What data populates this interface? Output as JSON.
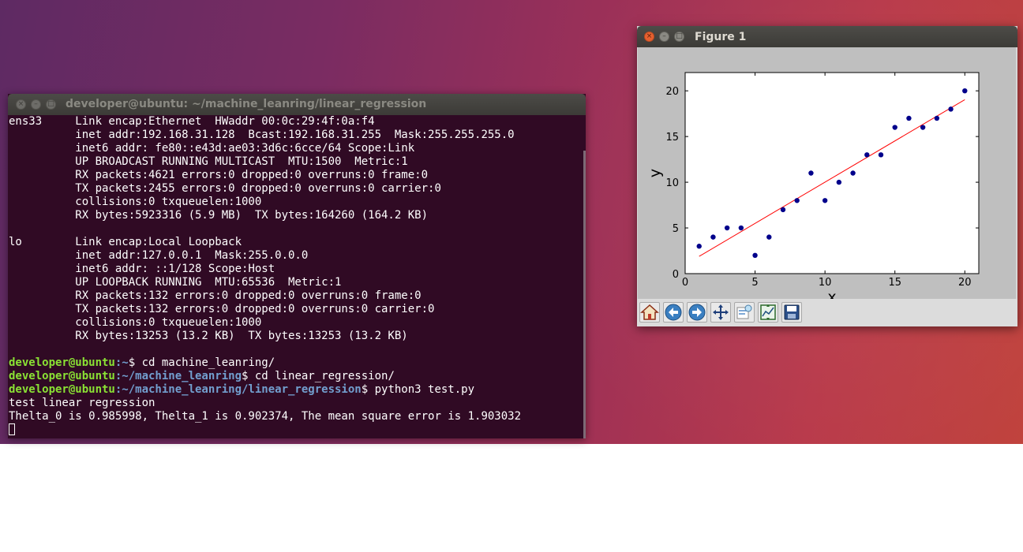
{
  "terminal": {
    "title": "developer@ubuntu: ~/machine_leanring/linear_regression",
    "lines": [
      "ens33     Link encap:Ethernet  HWaddr 00:0c:29:4f:0a:f4  ",
      "          inet addr:192.168.31.128  Bcast:192.168.31.255  Mask:255.255.255.0",
      "          inet6 addr: fe80::e43d:ae03:3d6c:6cce/64 Scope:Link",
      "          UP BROADCAST RUNNING MULTICAST  MTU:1500  Metric:1",
      "          RX packets:4621 errors:0 dropped:0 overruns:0 frame:0",
      "          TX packets:2455 errors:0 dropped:0 overruns:0 carrier:0",
      "          collisions:0 txqueuelen:1000 ",
      "          RX bytes:5923316 (5.9 MB)  TX bytes:164260 (164.2 KB)",
      "",
      "lo        Link encap:Local Loopback  ",
      "          inet addr:127.0.0.1  Mask:255.0.0.0",
      "          inet6 addr: ::1/128 Scope:Host",
      "          UP LOOPBACK RUNNING  MTU:65536  Metric:1",
      "          RX packets:132 errors:0 dropped:0 overruns:0 frame:0",
      "          TX packets:132 errors:0 dropped:0 overruns:0 carrier:0",
      "          collisions:0 txqueuelen:1000 ",
      "          RX bytes:13253 (13.2 KB)  TX bytes:13253 (13.2 KB)",
      ""
    ],
    "prompt_user": "developer@ubuntu",
    "commands": [
      {
        "path": ":~",
        "cmd": "$ cd machine_leanring/"
      },
      {
        "path": ":~/machine_leanring",
        "cmd": "$ cd linear_regression/"
      },
      {
        "path": ":~/machine_leanring/linear_regression",
        "cmd": "$ python3 test.py"
      }
    ],
    "output": [
      "test linear regression",
      "Theltа_0 is 0.985998, Thelta_1 is 0.902374, The mean square error is 1.903032"
    ],
    "colors": {
      "background": "#300a24",
      "user": "#8ae234",
      "path": "#729fcf"
    }
  },
  "figure": {
    "title": "Figure 1",
    "toolbar": [
      {
        "icon": "home-icon"
      },
      {
        "icon": "back-arrow-icon"
      },
      {
        "icon": "forward-arrow-icon"
      },
      {
        "icon": "pan-icon"
      },
      {
        "icon": "zoom-icon"
      },
      {
        "icon": "subplots-icon"
      },
      {
        "icon": "save-icon"
      }
    ]
  },
  "chart_data": {
    "type": "scatter",
    "xlabel": "x",
    "ylabel": "y",
    "xlim": [
      0,
      21
    ],
    "ylim": [
      0,
      22
    ],
    "xticks": [
      0,
      5,
      10,
      15,
      20
    ],
    "yticks": [
      0,
      5,
      10,
      15,
      20
    ],
    "points": {
      "x": [
        1,
        2,
        3,
        4,
        5,
        6,
        7,
        8,
        9,
        10,
        11,
        12,
        13,
        14,
        15,
        16,
        17,
        18,
        19,
        20
      ],
      "y": [
        3,
        4,
        5,
        5,
        2,
        4,
        7,
        8,
        11,
        8,
        10,
        11,
        13,
        13,
        16,
        17,
        16,
        17,
        18,
        20
      ],
      "color": "#00008b"
    },
    "fit_line": {
      "intercept": 0.985998,
      "slope": 0.902374,
      "x_range": [
        1,
        20
      ],
      "color": "#ff0000"
    },
    "grid": false
  }
}
